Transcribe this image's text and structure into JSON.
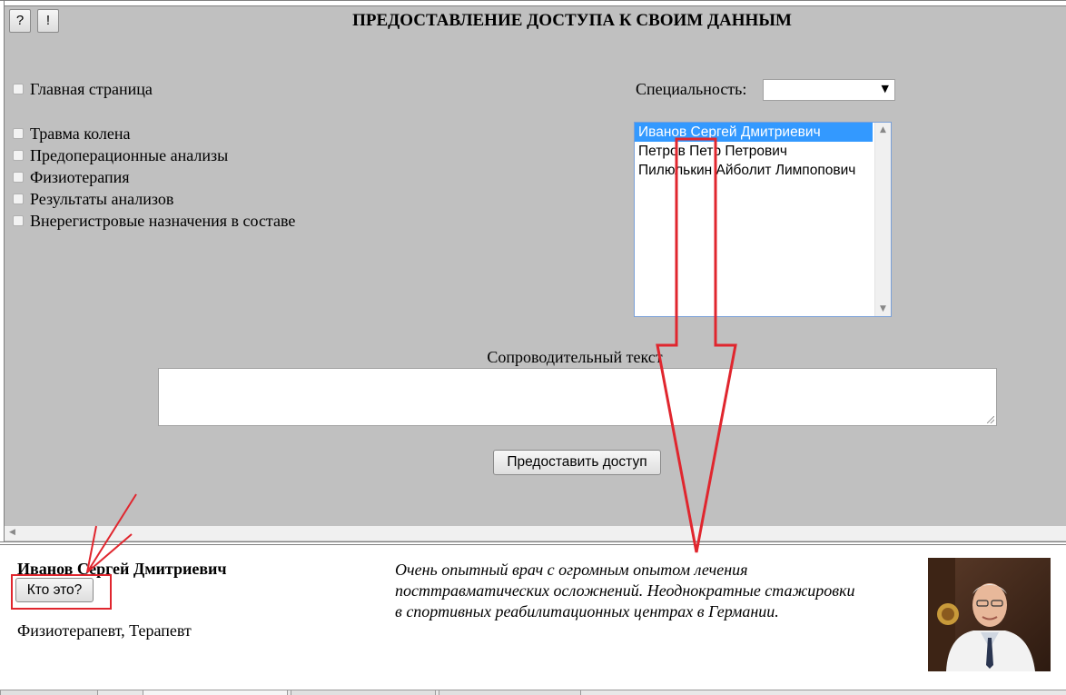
{
  "toolbar": {
    "help_label": "?",
    "alert_label": "!"
  },
  "page_title": "ПРЕДОСТАВЛЕНИЕ ДОСТУПА К СВОИМ ДАННЫМ",
  "sections": {
    "main": {
      "label": "Главная страница",
      "checked": false
    },
    "items": [
      {
        "label": "Травма колена",
        "checked": false
      },
      {
        "label": "Предоперационные анализы",
        "checked": false
      },
      {
        "label": "Физиотерапия",
        "checked": false
      },
      {
        "label": "Результаты анализов",
        "checked": false
      },
      {
        "label": "Внерегистровые назначения в составе",
        "checked": false
      }
    ]
  },
  "specialty": {
    "label": "Специальность:",
    "value": ""
  },
  "doctors_list": {
    "items": [
      {
        "label": "Иванов Сергей Дмитриевич",
        "selected": true
      },
      {
        "label": "Петров Петр Петрович",
        "selected": false
      },
      {
        "label": "Пилюлькин Айболит Лимпопович",
        "selected": false
      }
    ]
  },
  "cover_text": {
    "label": "Сопроводительный текст",
    "value": ""
  },
  "grant_button": "Предоставить доступ",
  "doctor_card": {
    "name": "Иванов Сергей Дмитриевич",
    "who_button": "Кто это?",
    "specialties": "Физиотерапевт, Терапевт",
    "description": "Очень опытный врач с огромным опытом лечения посттравматических осложнений. Неоднократные стажировки в спортивных реабилитационных центрах в Германии."
  },
  "annotation_colors": {
    "red": "#e0262e",
    "selection": "#3399ff"
  }
}
